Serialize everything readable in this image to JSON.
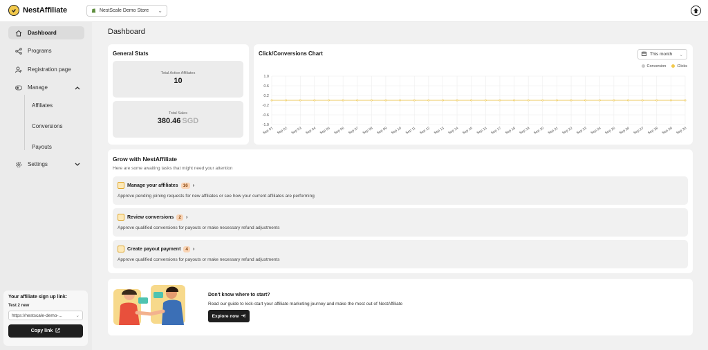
{
  "app": {
    "name": "NestAffiliate"
  },
  "store_selector": {
    "value": "NestScale Demo Store"
  },
  "sidebar": {
    "items": [
      {
        "label": "Dashboard"
      },
      {
        "label": "Programs"
      },
      {
        "label": "Registration page"
      },
      {
        "label": "Manage"
      },
      {
        "label": "Settings"
      }
    ],
    "manage_sub": [
      {
        "label": "Affiliates"
      },
      {
        "label": "Conversions"
      },
      {
        "label": "Payouts"
      }
    ],
    "signup": {
      "title": "Your affiliate sign up link:",
      "program": "Test 2 new",
      "link_value": "https://nestscale-demo-...",
      "copy_label": "Copy link"
    }
  },
  "main": {
    "page_title": "Dashboard",
    "general_stats": {
      "title": "General Stats",
      "active_affiliates_label": "Total Active Affiliates",
      "active_affiliates_value": "10",
      "total_sales_label": "Total Sales",
      "total_sales_value": "380.46",
      "total_sales_currency": "SGD"
    },
    "chart_card": {
      "title": "Click/Conversions Chart",
      "period": "This month"
    },
    "grow": {
      "title": "Grow with NestAffiliate",
      "subtitle": "Here are some awaiting tasks that might need your attention",
      "tasks": [
        {
          "title": "Manage your affiliates",
          "count": "16",
          "desc": "Approve pending joining requests for new affiliates or see how your current affiliates are performing"
        },
        {
          "title": "Review conversions",
          "count": "2",
          "desc": "Approve qualified conversions for payouts or make necessary refund adjustments"
        },
        {
          "title": "Create payout payment",
          "count": "4",
          "desc": "Approve qualified conversions for payouts or make necessary refund adjustments"
        }
      ]
    },
    "cta": {
      "title": "Don't know where to start?",
      "desc": "Read our guide to kick-start your affiliate marketing journey and make the most out of NestAffiliate",
      "button": "Explore now"
    }
  },
  "colors": {
    "conversion": "#c8c8c8",
    "clicks": "#f2c94c",
    "dark": "#1f1f1f"
  },
  "chart_data": {
    "type": "line",
    "title": "Click/Conversions Chart",
    "x": [
      "Sep 01",
      "Sep 02",
      "Sep 03",
      "Sep 04",
      "Sep 05",
      "Sep 06",
      "Sep 07",
      "Sep 08",
      "Sep 09",
      "Sep 10",
      "Sep 11",
      "Sep 12",
      "Sep 13",
      "Sep 14",
      "Sep 15",
      "Sep 16",
      "Sep 17",
      "Sep 18",
      "Sep 19",
      "Sep 20",
      "Sep 21",
      "Sep 22",
      "Sep 23",
      "Sep 24",
      "Sep 25",
      "Sep 26",
      "Sep 27",
      "Sep 28",
      "Sep 29",
      "Sep 30"
    ],
    "series": [
      {
        "name": "Conversion",
        "values": [
          0,
          0,
          0,
          0,
          0,
          0,
          0,
          0,
          0,
          0,
          0,
          0,
          0,
          0,
          0,
          0,
          0,
          0,
          0,
          0,
          0,
          0,
          0,
          0,
          0,
          0,
          0,
          0,
          0,
          0
        ]
      },
      {
        "name": "Clicks",
        "values": [
          0,
          0,
          0,
          0,
          0,
          0,
          0,
          0,
          0,
          0,
          0,
          0,
          0,
          0,
          0,
          0,
          0,
          0,
          0,
          0,
          0,
          0,
          0,
          0,
          0,
          0,
          0,
          0,
          0,
          0
        ]
      }
    ],
    "yticks": [
      "1.0",
      "0.6",
      "0.2",
      "-0.2",
      "-0.6",
      "-1.0"
    ],
    "ylim": [
      -1,
      1
    ],
    "grid": true,
    "legend": "top-right"
  }
}
